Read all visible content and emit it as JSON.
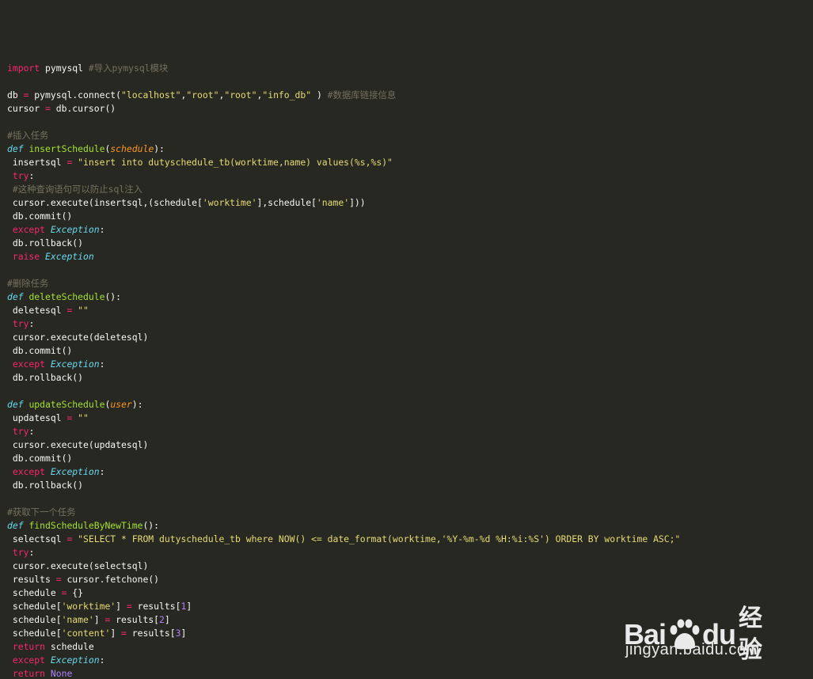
{
  "code_lines": [
    [],
    [
      {
        "t": "kw",
        "s": "import"
      },
      {
        "t": "plain",
        "s": " pymysql "
      },
      {
        "t": "cm",
        "s": "#导入pymysql模块"
      }
    ],
    [],
    [
      {
        "t": "plain",
        "s": "db "
      },
      {
        "t": "op",
        "s": "="
      },
      {
        "t": "plain",
        "s": " pymysql.connect("
      },
      {
        "t": "str",
        "s": "\"localhost\""
      },
      {
        "t": "plain",
        "s": ","
      },
      {
        "t": "str",
        "s": "\"root\""
      },
      {
        "t": "plain",
        "s": ","
      },
      {
        "t": "str",
        "s": "\"root\""
      },
      {
        "t": "plain",
        "s": ","
      },
      {
        "t": "str",
        "s": "\"info_db\""
      },
      {
        "t": "plain",
        "s": " ) "
      },
      {
        "t": "cm",
        "s": "#数据库链接信息"
      }
    ],
    [
      {
        "t": "plain",
        "s": "cursor "
      },
      {
        "t": "op",
        "s": "="
      },
      {
        "t": "plain",
        "s": " db.cursor()"
      }
    ],
    [],
    [
      {
        "t": "cm",
        "s": "#插入任务"
      }
    ],
    [
      {
        "t": "def",
        "s": "def"
      },
      {
        "t": "plain",
        "s": " "
      },
      {
        "t": "fn",
        "s": "insertSchedule"
      },
      {
        "t": "plain",
        "s": "("
      },
      {
        "t": "param",
        "s": "schedule"
      },
      {
        "t": "plain",
        "s": "):"
      }
    ],
    [
      {
        "t": "plain",
        "s": " insertsql "
      },
      {
        "t": "op",
        "s": "="
      },
      {
        "t": "plain",
        "s": " "
      },
      {
        "t": "str",
        "s": "\"insert into dutyschedule_tb(worktime,name) values(%s,%s)\""
      }
    ],
    [
      {
        "t": "plain",
        "s": " "
      },
      {
        "t": "kw",
        "s": "try"
      },
      {
        "t": "plain",
        "s": ":"
      }
    ],
    [
      {
        "t": "plain",
        "s": " "
      },
      {
        "t": "cm",
        "s": "#这种查询语句可以防止sql注入"
      }
    ],
    [
      {
        "t": "plain",
        "s": " cursor.execute(insertsql,(schedule["
      },
      {
        "t": "str",
        "s": "'worktime'"
      },
      {
        "t": "plain",
        "s": "],schedule["
      },
      {
        "t": "str",
        "s": "'name'"
      },
      {
        "t": "plain",
        "s": "]))"
      }
    ],
    [
      {
        "t": "plain",
        "s": " db.commit()"
      }
    ],
    [
      {
        "t": "plain",
        "s": " "
      },
      {
        "t": "kw",
        "s": "except"
      },
      {
        "t": "plain",
        "s": " "
      },
      {
        "t": "cls",
        "s": "Exception"
      },
      {
        "t": "plain",
        "s": ":"
      }
    ],
    [
      {
        "t": "plain",
        "s": " db.rollback()"
      }
    ],
    [
      {
        "t": "plain",
        "s": " "
      },
      {
        "t": "kw",
        "s": "raise"
      },
      {
        "t": "plain",
        "s": " "
      },
      {
        "t": "cls",
        "s": "Exception"
      }
    ],
    [],
    [
      {
        "t": "cm",
        "s": "#删除任务"
      }
    ],
    [
      {
        "t": "def",
        "s": "def"
      },
      {
        "t": "plain",
        "s": " "
      },
      {
        "t": "fn",
        "s": "deleteSchedule"
      },
      {
        "t": "plain",
        "s": "():"
      }
    ],
    [
      {
        "t": "plain",
        "s": " deletesql "
      },
      {
        "t": "op",
        "s": "="
      },
      {
        "t": "plain",
        "s": " "
      },
      {
        "t": "str",
        "s": "\"\""
      }
    ],
    [
      {
        "t": "plain",
        "s": " "
      },
      {
        "t": "kw",
        "s": "try"
      },
      {
        "t": "plain",
        "s": ":"
      }
    ],
    [
      {
        "t": "plain",
        "s": " cursor.execute(deletesql)"
      }
    ],
    [
      {
        "t": "plain",
        "s": " db.commit()"
      }
    ],
    [
      {
        "t": "plain",
        "s": " "
      },
      {
        "t": "kw",
        "s": "except"
      },
      {
        "t": "plain",
        "s": " "
      },
      {
        "t": "cls",
        "s": "Exception"
      },
      {
        "t": "plain",
        "s": ":"
      }
    ],
    [
      {
        "t": "plain",
        "s": " db.rollback()"
      }
    ],
    [],
    [
      {
        "t": "def",
        "s": "def"
      },
      {
        "t": "plain",
        "s": " "
      },
      {
        "t": "fn",
        "s": "updateSchedule"
      },
      {
        "t": "plain",
        "s": "("
      },
      {
        "t": "param",
        "s": "user"
      },
      {
        "t": "plain",
        "s": "):"
      }
    ],
    [
      {
        "t": "plain",
        "s": " updatesql "
      },
      {
        "t": "op",
        "s": "="
      },
      {
        "t": "plain",
        "s": " "
      },
      {
        "t": "str",
        "s": "\"\""
      }
    ],
    [
      {
        "t": "plain",
        "s": " "
      },
      {
        "t": "kw",
        "s": "try"
      },
      {
        "t": "plain",
        "s": ":"
      }
    ],
    [
      {
        "t": "plain",
        "s": " cursor.execute(updatesql)"
      }
    ],
    [
      {
        "t": "plain",
        "s": " db.commit()"
      }
    ],
    [
      {
        "t": "plain",
        "s": " "
      },
      {
        "t": "kw",
        "s": "except"
      },
      {
        "t": "plain",
        "s": " "
      },
      {
        "t": "cls",
        "s": "Exception"
      },
      {
        "t": "plain",
        "s": ":"
      }
    ],
    [
      {
        "t": "plain",
        "s": " db.rollback()"
      }
    ],
    [],
    [
      {
        "t": "cm",
        "s": "#获取下一个任务"
      }
    ],
    [
      {
        "t": "def",
        "s": "def"
      },
      {
        "t": "plain",
        "s": " "
      },
      {
        "t": "fn",
        "s": "findScheduleByNewTime"
      },
      {
        "t": "plain",
        "s": "():"
      }
    ],
    [
      {
        "t": "plain",
        "s": " selectsql "
      },
      {
        "t": "op",
        "s": "="
      },
      {
        "t": "plain",
        "s": " "
      },
      {
        "t": "str",
        "s": "\"SELECT * FROM dutyschedule_tb where NOW() <= date_format(worktime,'%Y-%m-%d %H:%i:%S') ORDER BY worktime ASC;\""
      }
    ],
    [
      {
        "t": "plain",
        "s": " "
      },
      {
        "t": "kw",
        "s": "try"
      },
      {
        "t": "plain",
        "s": ":"
      }
    ],
    [
      {
        "t": "plain",
        "s": " cursor.execute(selectsql)"
      }
    ],
    [
      {
        "t": "plain",
        "s": " results "
      },
      {
        "t": "op",
        "s": "="
      },
      {
        "t": "plain",
        "s": " cursor.fetchone()"
      }
    ],
    [
      {
        "t": "plain",
        "s": " schedule "
      },
      {
        "t": "op",
        "s": "="
      },
      {
        "t": "plain",
        "s": " {}"
      }
    ],
    [
      {
        "t": "plain",
        "s": " schedule["
      },
      {
        "t": "str",
        "s": "'worktime'"
      },
      {
        "t": "plain",
        "s": "] "
      },
      {
        "t": "op",
        "s": "="
      },
      {
        "t": "plain",
        "s": " results["
      },
      {
        "t": "num",
        "s": "1"
      },
      {
        "t": "plain",
        "s": "]"
      }
    ],
    [
      {
        "t": "plain",
        "s": " schedule["
      },
      {
        "t": "str",
        "s": "'name'"
      },
      {
        "t": "plain",
        "s": "] "
      },
      {
        "t": "op",
        "s": "="
      },
      {
        "t": "plain",
        "s": " results["
      },
      {
        "t": "num",
        "s": "2"
      },
      {
        "t": "plain",
        "s": "]"
      }
    ],
    [
      {
        "t": "plain",
        "s": " schedule["
      },
      {
        "t": "str",
        "s": "'content'"
      },
      {
        "t": "plain",
        "s": "] "
      },
      {
        "t": "op",
        "s": "="
      },
      {
        "t": "plain",
        "s": " results["
      },
      {
        "t": "num",
        "s": "3"
      },
      {
        "t": "plain",
        "s": "]"
      }
    ],
    [
      {
        "t": "plain",
        "s": " "
      },
      {
        "t": "kw",
        "s": "return"
      },
      {
        "t": "plain",
        "s": " schedule"
      }
    ],
    [
      {
        "t": "plain",
        "s": " "
      },
      {
        "t": "kw",
        "s": "except"
      },
      {
        "t": "plain",
        "s": " "
      },
      {
        "t": "cls",
        "s": "Exception"
      },
      {
        "t": "plain",
        "s": ":"
      }
    ],
    [
      {
        "t": "plain",
        "s": " "
      },
      {
        "t": "kw",
        "s": "return"
      },
      {
        "t": "plain",
        "s": " "
      },
      {
        "t": "const",
        "s": "None"
      }
    ]
  ],
  "watermark": {
    "brand_left": "Bai",
    "brand_right": "du",
    "brand_cn": "经验",
    "url": "jingyan.baidu.com"
  },
  "theme": {
    "background": "#272822",
    "keyword": "#f92672",
    "string": "#e6db74",
    "comment": "#75715e",
    "function": "#a6e22e",
    "class": "#66d9ef",
    "number": "#ae81ff"
  }
}
